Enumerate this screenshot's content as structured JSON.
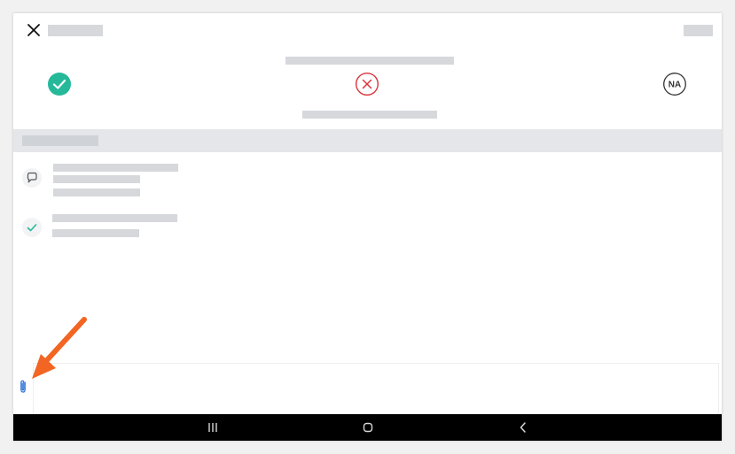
{
  "app": {
    "title": ""
  },
  "header": {
    "close_icon": "close-icon",
    "action_label": ""
  },
  "status": {
    "pass_icon": "check-circle-icon",
    "fail_icon": "x-circle-icon",
    "na_label": "NA",
    "colors": {
      "pass": "#25b99a",
      "fail": "#d9343a",
      "na": "#333333"
    }
  },
  "activity": [
    {
      "type": "comment",
      "icon": "comment-icon"
    },
    {
      "type": "status-change",
      "icon": "check-icon"
    }
  ],
  "composer": {
    "attach_icon": "paperclip-icon"
  },
  "system_nav": {
    "recents_icon": "recents-icon",
    "home_icon": "home-icon",
    "back_icon": "back-icon"
  },
  "annotation": {
    "arrow_color": "#f26522"
  }
}
